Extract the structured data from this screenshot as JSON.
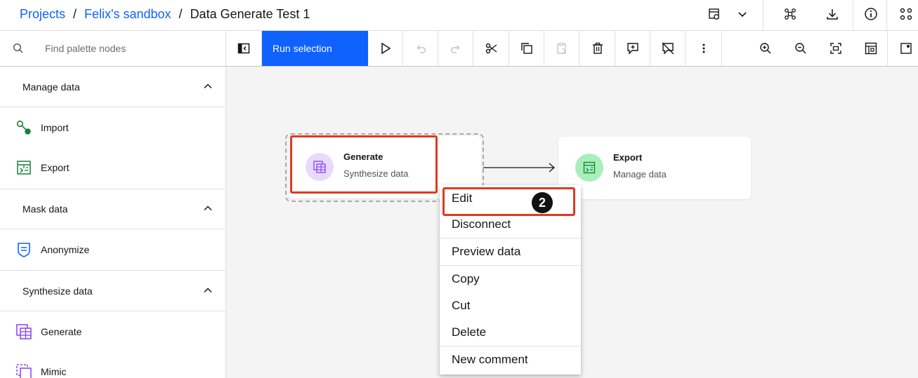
{
  "breadcrumb": {
    "projects": "Projects",
    "sandbox": "Felix's sandbox",
    "current": "Data Generate Test 1",
    "separator": "/"
  },
  "header_icons": [
    "flow-settings-icon",
    "chevron-down-icon",
    "hub-icon",
    "download-icon",
    "info-icon",
    "apps-icon"
  ],
  "search": {
    "placeholder": "Find palette nodes"
  },
  "toolbar": {
    "run_selection_label": "Run selection",
    "tools": [
      "palette-toggle-icon",
      "run-icon",
      "undo-icon",
      "redo-icon",
      "cut-icon",
      "copy-icon",
      "paste-icon",
      "delete-icon",
      "add-comment-icon",
      "hide-comments-icon",
      "overflow-icon",
      "zoom-in-icon",
      "zoom-out-icon",
      "fit-to-screen-icon",
      "minimap-icon",
      "settings-icon"
    ]
  },
  "sidebar": {
    "categories": [
      {
        "label": "Manage data",
        "items": [
          {
            "label": "Import",
            "icon": "import-icon"
          },
          {
            "label": "Export",
            "icon": "export-icon"
          }
        ]
      },
      {
        "label": "Mask data",
        "items": [
          {
            "label": "Anonymize",
            "icon": "anonymize-icon"
          }
        ]
      },
      {
        "label": "Synthesize data",
        "items": [
          {
            "label": "Generate",
            "icon": "generate-icon"
          },
          {
            "label": "Mimic",
            "icon": "mimic-icon"
          }
        ]
      }
    ]
  },
  "canvas": {
    "nodes": [
      {
        "title": "Generate",
        "subtitle": "Synthesize data",
        "color": "#e8daff",
        "icon_color": "#8a3ffc"
      },
      {
        "title": "Export",
        "subtitle": "Manage data",
        "color": "#a7f0ba",
        "icon_color": "#198038"
      }
    ]
  },
  "context_menu": {
    "items": [
      "Edit",
      "Disconnect",
      "Preview data",
      "Copy",
      "Cut",
      "Delete",
      "New comment"
    ]
  },
  "step_badge": "2",
  "colors": {
    "accent": "#0f62fe",
    "highlight": "#e03a1e"
  }
}
